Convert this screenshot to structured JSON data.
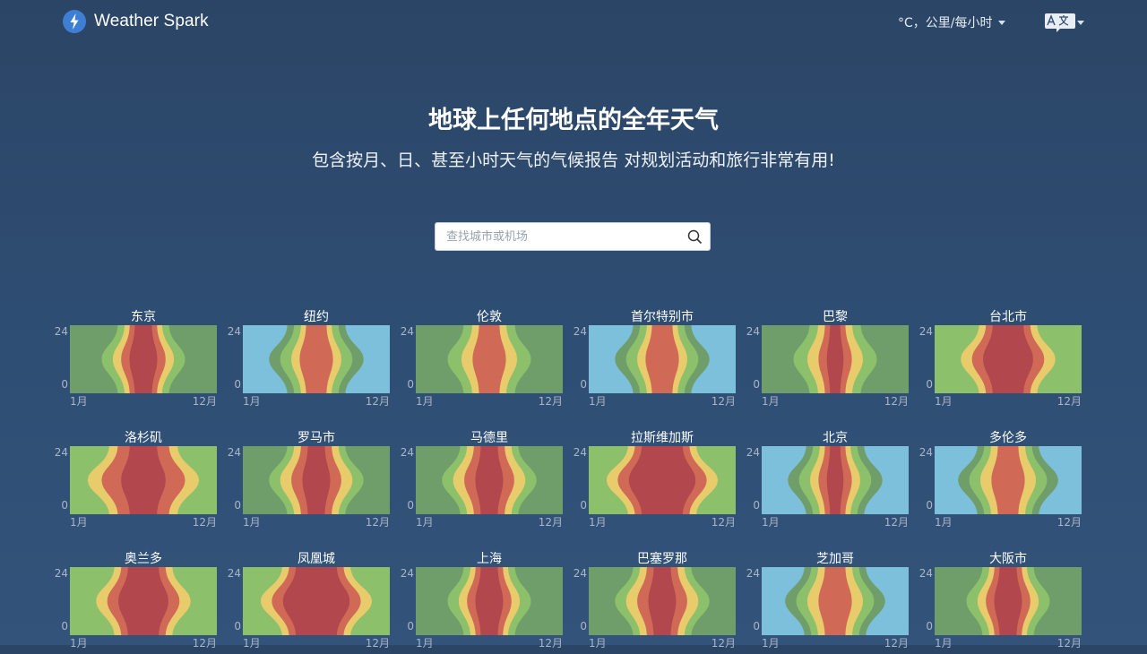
{
  "header": {
    "logo_text": "Weather Spark",
    "units_label": "°C，公里/每小时",
    "lang_icon": "translate-icon"
  },
  "hero": {
    "title": "地球上任何地点的全年天气",
    "subtitle": "包含按月、日、甚至小时天气的气候报告 对规划活动和旅行非常有用!"
  },
  "search": {
    "placeholder": "查找城市或机场",
    "icon": "search-icon"
  },
  "axis": {
    "y_top": "24",
    "y_bottom": "0",
    "x_left": "1月",
    "x_right": "12月"
  },
  "colors": {
    "cold": "#7cc0dc",
    "cool": "#6f9e6b",
    "comfortable": "#8cc06b",
    "warm": "#e8cc6c",
    "hot": "#d06a56",
    "sweltering": "#b2474d"
  },
  "cities": [
    {
      "name": "东京",
      "climate": "humid",
      "peak": 3
    },
    {
      "name": "纽约",
      "climate": "continental",
      "peak": 3
    },
    {
      "name": "伦敦",
      "climate": "mild",
      "peak": 2
    },
    {
      "name": "首尔特别市",
      "climate": "continental",
      "peak": 3
    },
    {
      "name": "巴黎",
      "climate": "mild",
      "peak": 3
    },
    {
      "name": "台北市",
      "climate": "tropical",
      "peak": 4
    },
    {
      "name": "洛杉矶",
      "climate": "dry",
      "peak": 3
    },
    {
      "name": "罗马市",
      "climate": "med",
      "peak": 4
    },
    {
      "name": "马德里",
      "climate": "med",
      "peak": 4
    },
    {
      "name": "拉斯维加斯",
      "climate": "desert",
      "peak": 5
    },
    {
      "name": "北京",
      "climate": "continental",
      "peak": 4
    },
    {
      "name": "多伦多",
      "climate": "cold",
      "peak": 3
    },
    {
      "name": "奥兰多",
      "climate": "tropical",
      "peak": 4
    },
    {
      "name": "凤凰城",
      "climate": "desert",
      "peak": 5
    },
    {
      "name": "上海",
      "climate": "humid",
      "peak": 4
    },
    {
      "name": "巴塞罗那",
      "climate": "med",
      "peak": 3
    },
    {
      "name": "芝加哥",
      "climate": "cold",
      "peak": 3
    },
    {
      "name": "大阪市",
      "climate": "humid",
      "peak": 4
    }
  ]
}
